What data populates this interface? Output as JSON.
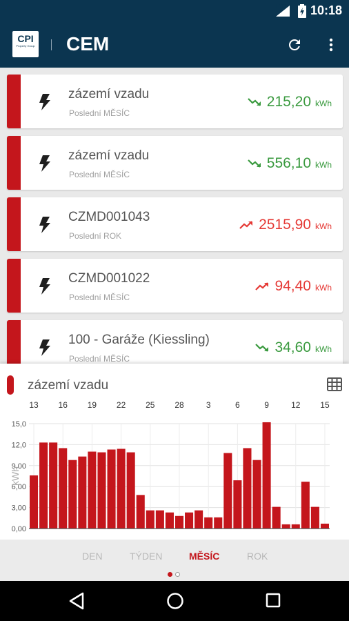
{
  "status_bar": {
    "time": "10:18",
    "network": "LTE"
  },
  "app_bar": {
    "company_logo": "CPI",
    "company_logo_sub": "Property Group",
    "app_logo": "CEM",
    "refresh_icon": "refresh-icon",
    "menu_icon": "more-vert-icon"
  },
  "meters": [
    {
      "name": "zázemí vzadu",
      "period": "Poslední MĚSÍC",
      "value": "215,20",
      "unit": "kWh",
      "trend": "down",
      "color": "#3a9a3f"
    },
    {
      "name": "zázemí vzadu",
      "period": "Poslední MĚSÍC",
      "value": "556,10",
      "unit": "kWh",
      "trend": "down",
      "color": "#3a9a3f"
    },
    {
      "name": "CZMD001043",
      "period": "Poslední ROK",
      "value": "2515,90",
      "unit": "kWh",
      "trend": "up",
      "color": "#e53935"
    },
    {
      "name": "CZMD001022",
      "period": "Poslední MĚSÍC",
      "value": "94,40",
      "unit": "kWh",
      "trend": "up",
      "color": "#e53935"
    },
    {
      "name": "100 - Garáže (Kiessling)",
      "period": "Poslední MĚSÍC",
      "value": "34,60",
      "unit": "kWh",
      "trend": "down",
      "color": "#3a9a3f"
    }
  ],
  "detail_panel": {
    "title": "zázemí vzadu",
    "table_icon": "table-icon"
  },
  "chart_data": {
    "type": "bar",
    "ylabel": "kWh",
    "ylim": [
      0,
      15
    ],
    "yticks": [
      "0,00",
      "3,00",
      "6,00",
      "9,00",
      "12,0",
      "15,0"
    ],
    "xtick_labels": [
      {
        "label": "13",
        "index": 0
      },
      {
        "label": "16",
        "index": 3
      },
      {
        "label": "19",
        "index": 6
      },
      {
        "label": "22",
        "index": 9
      },
      {
        "label": "25",
        "index": 12
      },
      {
        "label": "28",
        "index": 15
      },
      {
        "label": "3",
        "index": 18
      },
      {
        "label": "6",
        "index": 21
      },
      {
        "label": "9",
        "index": 24
      },
      {
        "label": "12",
        "index": 27
      },
      {
        "label": "15",
        "index": 30
      }
    ],
    "values": [
      7.6,
      12.3,
      12.3,
      11.5,
      9.8,
      10.3,
      11.0,
      10.9,
      11.3,
      11.4,
      10.9,
      4.8,
      2.6,
      2.6,
      2.3,
      1.8,
      2.3,
      2.6,
      1.6,
      1.6,
      10.8,
      6.9,
      11.5,
      9.8,
      15.2,
      3.1,
      0.6,
      0.6,
      6.7,
      3.1,
      0.7
    ],
    "bar_color": "#c4161c",
    "grid": true
  },
  "period_tabs": [
    {
      "label": "DEN",
      "active": false
    },
    {
      "label": "TÝDEN",
      "active": false
    },
    {
      "label": "MĚSÍC",
      "active": true
    },
    {
      "label": "ROK",
      "active": false
    }
  ],
  "nav_bar": {
    "back_icon": "back-icon",
    "home_icon": "home-icon",
    "recents_icon": "recents-icon"
  }
}
